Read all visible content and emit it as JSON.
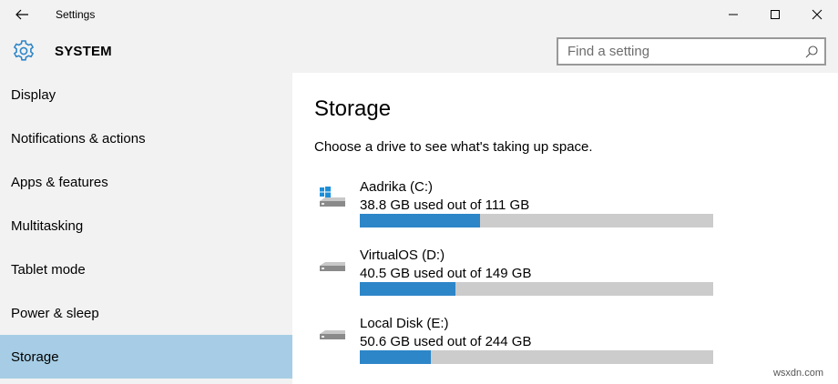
{
  "window": {
    "title": "Settings",
    "back_icon": "arrow-left-icon",
    "controls": [
      "minimize-icon",
      "maximize-icon",
      "close-icon"
    ]
  },
  "header": {
    "icon": "gear-icon",
    "section_title": "SYSTEM",
    "search_placeholder": "Find a setting",
    "search_value": "",
    "search_icon": "search-icon"
  },
  "sidebar": {
    "items": [
      {
        "label": "Display",
        "active": false
      },
      {
        "label": "Notifications & actions",
        "active": false
      },
      {
        "label": "Apps & features",
        "active": false
      },
      {
        "label": "Multitasking",
        "active": false
      },
      {
        "label": "Tablet mode",
        "active": false
      },
      {
        "label": "Power & sleep",
        "active": false
      },
      {
        "label": "Storage",
        "active": true
      }
    ]
  },
  "main": {
    "title": "Storage",
    "subtitle": "Choose a drive to see what's taking up space.",
    "drives": [
      {
        "name": "Aadrika (C:)",
        "usage": "38.8 GB used out of 111 GB",
        "used_fraction": 0.34,
        "icon": "windows-drive-icon"
      },
      {
        "name": "VirtualOS (D:)",
        "usage": "40.5 GB used out of 149 GB",
        "used_fraction": 0.27,
        "icon": "hard-drive-icon"
      },
      {
        "name": "Local Disk (E:)",
        "usage": "50.6 GB used out of 244 GB",
        "used_fraction": 0.2,
        "icon": "hard-drive-icon"
      }
    ]
  },
  "colors": {
    "chrome_bg": "#f2f2f2",
    "active_nav": "#a6cde5",
    "accent": "#2d86c8",
    "bar_track": "#cccccc"
  },
  "watermark": "wsxdn.com"
}
